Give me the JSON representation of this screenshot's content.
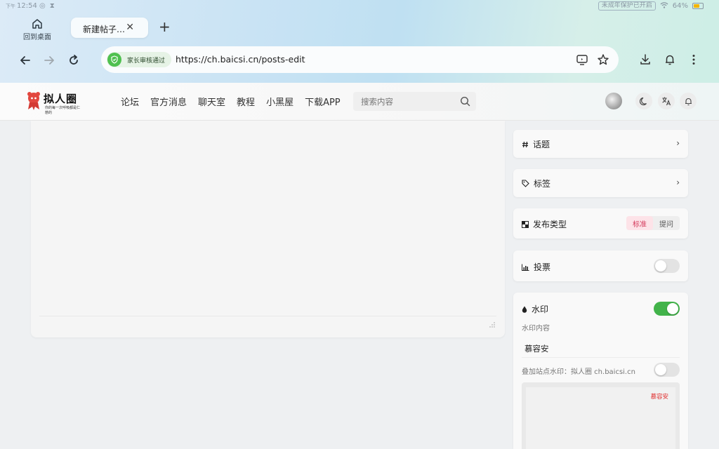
{
  "status_bar": {
    "period": "下午",
    "time": "12:54",
    "guard_label": "未成年保护已开启",
    "battery": "64%",
    "battery_color": "#f4b400"
  },
  "browser": {
    "home_label": "回到桌面",
    "tab_title": "新建帖子…",
    "tab_close_icon": "close-icon",
    "new_tab_icon": "plus-icon",
    "parental_label": "家长审核通过",
    "url": "https://ch.baicsi.cn/posts-edit",
    "icons": [
      "back-icon",
      "forward-icon",
      "reload-icon",
      "screen-icon",
      "star-icon",
      "download-icon",
      "bell-icon",
      "more-icon"
    ]
  },
  "site": {
    "logo_text": "拟人圈",
    "logo_subtitle": "你的每一次呼吸都是仁慈的",
    "nav": [
      "论坛",
      "官方消息",
      "聊天室",
      "教程",
      "小黑屋",
      "下载APP"
    ],
    "search_placeholder": "搜索内容",
    "header_icons": [
      "moon-icon",
      "translate-icon",
      "bell-icon"
    ]
  },
  "sidebar": {
    "topic_label": "话题",
    "tag_label": "标签",
    "publish_type_label": "发布类型",
    "publish_types": [
      "标准",
      "提问"
    ],
    "publish_type_selected": "标准",
    "vote_label": "投票",
    "vote_enabled": false,
    "watermark_label": "水印",
    "watermark_enabled": true,
    "watermark_content_label": "水印内容",
    "watermark_content": "慕容安",
    "site_watermark_label": "叠加站点水印：拟人圈 ch.baicsi.cn",
    "site_watermark_enabled": false,
    "preview_watermark": "慕容安",
    "accent_color": "#d43a5b",
    "toggle_on_color": "#42b34a"
  }
}
